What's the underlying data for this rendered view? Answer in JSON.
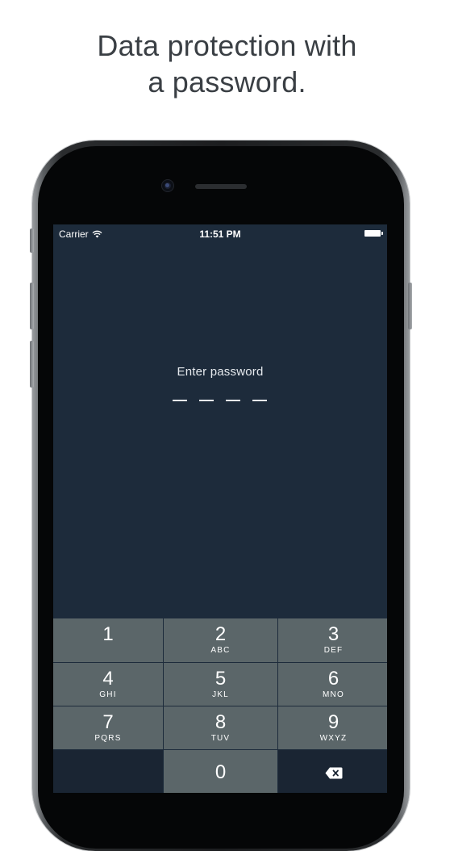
{
  "promo": {
    "headline_line1": "Data protection with",
    "headline_line2": "a password."
  },
  "status_bar": {
    "carrier": "Carrier",
    "time": "11:51 PM",
    "icons": [
      "wifi-icon",
      "battery-icon"
    ]
  },
  "lock_screen": {
    "prompt": "Enter password",
    "pin_length": 4,
    "entered_count": 0
  },
  "keypad": {
    "keys": [
      {
        "digit": "1",
        "letters": ""
      },
      {
        "digit": "2",
        "letters": "ABC"
      },
      {
        "digit": "3",
        "letters": "DEF"
      },
      {
        "digit": "4",
        "letters": "GHI"
      },
      {
        "digit": "5",
        "letters": "JKL"
      },
      {
        "digit": "6",
        "letters": "MNO"
      },
      {
        "digit": "7",
        "letters": "PQRS"
      },
      {
        "digit": "8",
        "letters": "TUV"
      },
      {
        "digit": "9",
        "letters": "WXYZ"
      },
      {
        "digit": "0",
        "letters": ""
      }
    ],
    "delete_icon": "backspace-icon"
  },
  "colors": {
    "screen_background": "#1d2b3b",
    "key_background": "#5b6669",
    "dark_key_background": "#1a2533",
    "headline_text": "#3a3f44"
  }
}
